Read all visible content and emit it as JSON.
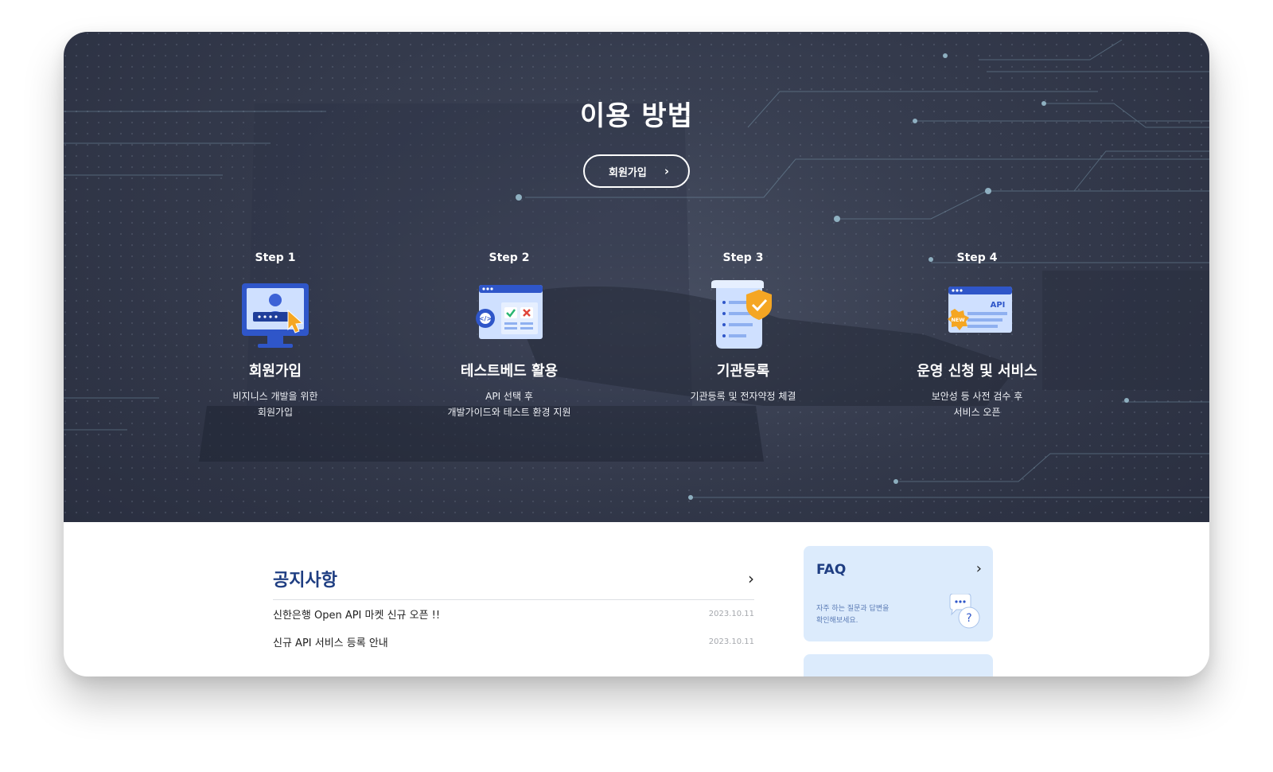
{
  "hero": {
    "title": "이용 방법",
    "signup_button": "회원가입"
  },
  "steps": [
    {
      "label": "Step 1",
      "title": "회원가입",
      "desc": [
        "비지니스 개발을 위한",
        "회원가입"
      ]
    },
    {
      "label": "Step 2",
      "title": "테스트베드 활용",
      "desc": [
        "API 선택 후",
        "개발가이드와 테스트 환경 지원"
      ]
    },
    {
      "label": "Step 3",
      "title": "기관등록",
      "desc": [
        "기관등록 및 전자약정 체결",
        ""
      ]
    },
    {
      "label": "Step 4",
      "title": "운영 신청 및 서비스",
      "desc": [
        "보안성 등 사전 검수 후",
        "서비스 오픈"
      ]
    }
  ],
  "notice": {
    "title": "공지사항",
    "items": [
      {
        "text": "신한은행 Open API 마켓 신규 오픈 !!",
        "date": "2023.10.11"
      },
      {
        "text": "신규 API 서비스 등록 안내",
        "date": "2023.10.11"
      }
    ]
  },
  "faq": {
    "title": "FAQ",
    "desc": [
      "자주 하는 질문과 답변을",
      "확인해보세요."
    ]
  },
  "icons": {
    "step1": "user-monitor-icon",
    "step2": "test-window-icon",
    "step3": "document-shield-icon",
    "step4": "api-new-window-icon",
    "faq": "chat-question-icon"
  },
  "colors": {
    "accent": "#1f3e82",
    "faq_card": "#dcebfc",
    "hero_bg": "#343a4c",
    "icon_blue": "#3d62d6",
    "icon_orange": "#f5a623"
  }
}
